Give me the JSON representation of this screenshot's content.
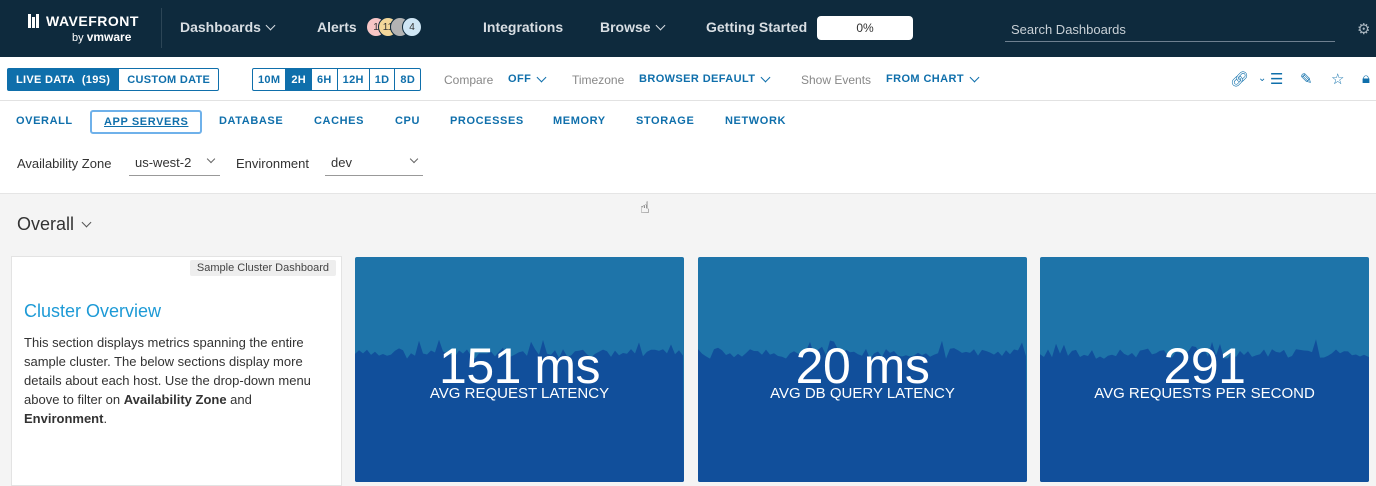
{
  "nav": {
    "logo_name": "WAVEFRONT",
    "logo_by": "by",
    "logo_vendor": "vmware",
    "dashboards": "Dashboards",
    "alerts": "Alerts",
    "alert_badges": [
      {
        "count": "1",
        "color": "#f7c6c6"
      },
      {
        "count": "11",
        "color": "#f3d79a"
      },
      {
        "count": "",
        "color": "#b3b3b3"
      },
      {
        "count": "4",
        "color": "#cfe6f5"
      }
    ],
    "integrations": "Integrations",
    "browse": "Browse",
    "getting_started": "Getting Started",
    "progress_label": "0%",
    "progress_value": 0,
    "search_placeholder": "Search Dashboards"
  },
  "toolbar": {
    "live_data": "LIVE DATA",
    "live_seconds": "(19S)",
    "custom_date": "CUSTOM DATE",
    "ranges": [
      "10M",
      "2H",
      "6H",
      "12H",
      "1D",
      "8D"
    ],
    "active_range": "2H",
    "compare_label": "Compare",
    "compare_value": "OFF",
    "timezone_label": "Timezone",
    "timezone_value": "BROWSER DEFAULT",
    "events_label": "Show Events",
    "events_value": "FROM CHART"
  },
  "tabs": [
    "OVERALL",
    "APP SERVERS",
    "DATABASE",
    "CACHES",
    "CPU",
    "PROCESSES",
    "MEMORY",
    "STORAGE",
    "NETWORK"
  ],
  "filters": {
    "az_label": "Availability Zone",
    "az_value": "us-west-2",
    "env_label": "Environment",
    "env_value": "dev"
  },
  "section": {
    "title": "Overall"
  },
  "text_card": {
    "tag": "Sample Cluster Dashboard",
    "title": "Cluster Overview",
    "body_1": "This section displays metrics spanning the entire sample cluster. The below sections display more details about each host. Use the drop-down menu above to filter on ",
    "body_bold_1": "Availability Zone",
    "body_2": " and ",
    "body_bold_2": "Environment",
    "body_3": "."
  },
  "kpis": [
    {
      "value": "151 ms",
      "label": "AVG REQUEST LATENCY"
    },
    {
      "value": "20 ms",
      "label": "AVG DB QUERY LATENCY"
    },
    {
      "value": "291",
      "label": "AVG REQUESTS PER SECOND"
    }
  ],
  "colors": {
    "nav_bg": "#0e2a3d",
    "accent": "#0f6fab",
    "kpi_top": "#1e74a9",
    "kpi_area": "#114f9b"
  }
}
